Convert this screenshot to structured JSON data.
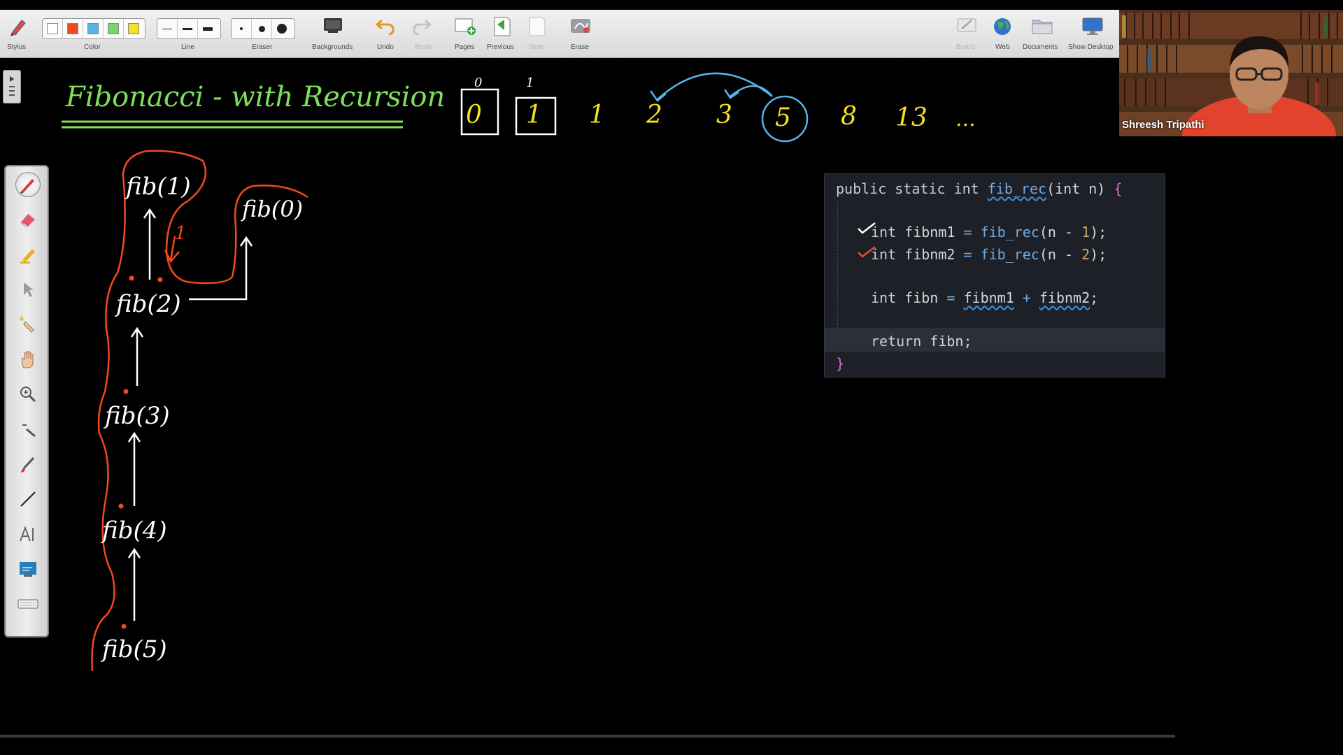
{
  "toolbar": {
    "stylus_label": "Stylus",
    "color_label": "Color",
    "line_label": "Line",
    "eraser_label": "Eraser",
    "backgrounds_label": "Backgrounds",
    "undo_label": "Undo",
    "redo_label": "Redo",
    "pages_label": "Pages",
    "previous_label": "Previous",
    "next_label": "Next",
    "erase_label": "Erase",
    "board_label": "Board",
    "web_label": "Web",
    "documents_label": "Documents",
    "show_desktop_label": "Show Desktop",
    "colors": [
      "#ffffff",
      "#f04a1e",
      "#56b4e9",
      "#7ad36b",
      "#f5e11d"
    ]
  },
  "whiteboard": {
    "title": "Fibonacci - with Recursion",
    "sequence": [
      "0",
      "1",
      "1",
      "2",
      "3",
      "5",
      "8",
      "13",
      "..."
    ],
    "sequence_indices": [
      "0",
      "1"
    ],
    "tree_nodes": [
      "fib(1)",
      "fib(0)",
      "fib(2)",
      "fib(3)",
      "fib(4)",
      "fib(5)"
    ],
    "return_value_note": "1",
    "colors": {
      "title": "#7ee05a",
      "sequence": "#f5e11d",
      "ink": "#ffffff",
      "trace": "#f04a1e",
      "arrows": "#56b4e9"
    }
  },
  "code": {
    "line1": {
      "public": "public",
      "static": "static",
      "int": "int",
      "fn": "fib_rec",
      "params": "(int n)",
      "brace": "{"
    },
    "line2": {
      "type": "int",
      "var": "fibnm1",
      "op": "=",
      "fn": "fib_rec",
      "open": "(n - ",
      "num": "1",
      "close": ");"
    },
    "line3": {
      "type": "int",
      "var": "fibnm2",
      "op": "=",
      "fn": "fib_rec",
      "open": "(n - ",
      "num": "2",
      "close": ");"
    },
    "line4": {
      "type": "int",
      "var": "fibn",
      "op": "=",
      "a": "fibnm1",
      "plus": "+",
      "b": "fibnm2",
      "end": ";"
    },
    "line5": {
      "kw": "return",
      "rest": "fibn;"
    },
    "line6": {
      "brace": "}"
    }
  },
  "webcam": {
    "participant_name": "Shreesh Tripathi"
  }
}
